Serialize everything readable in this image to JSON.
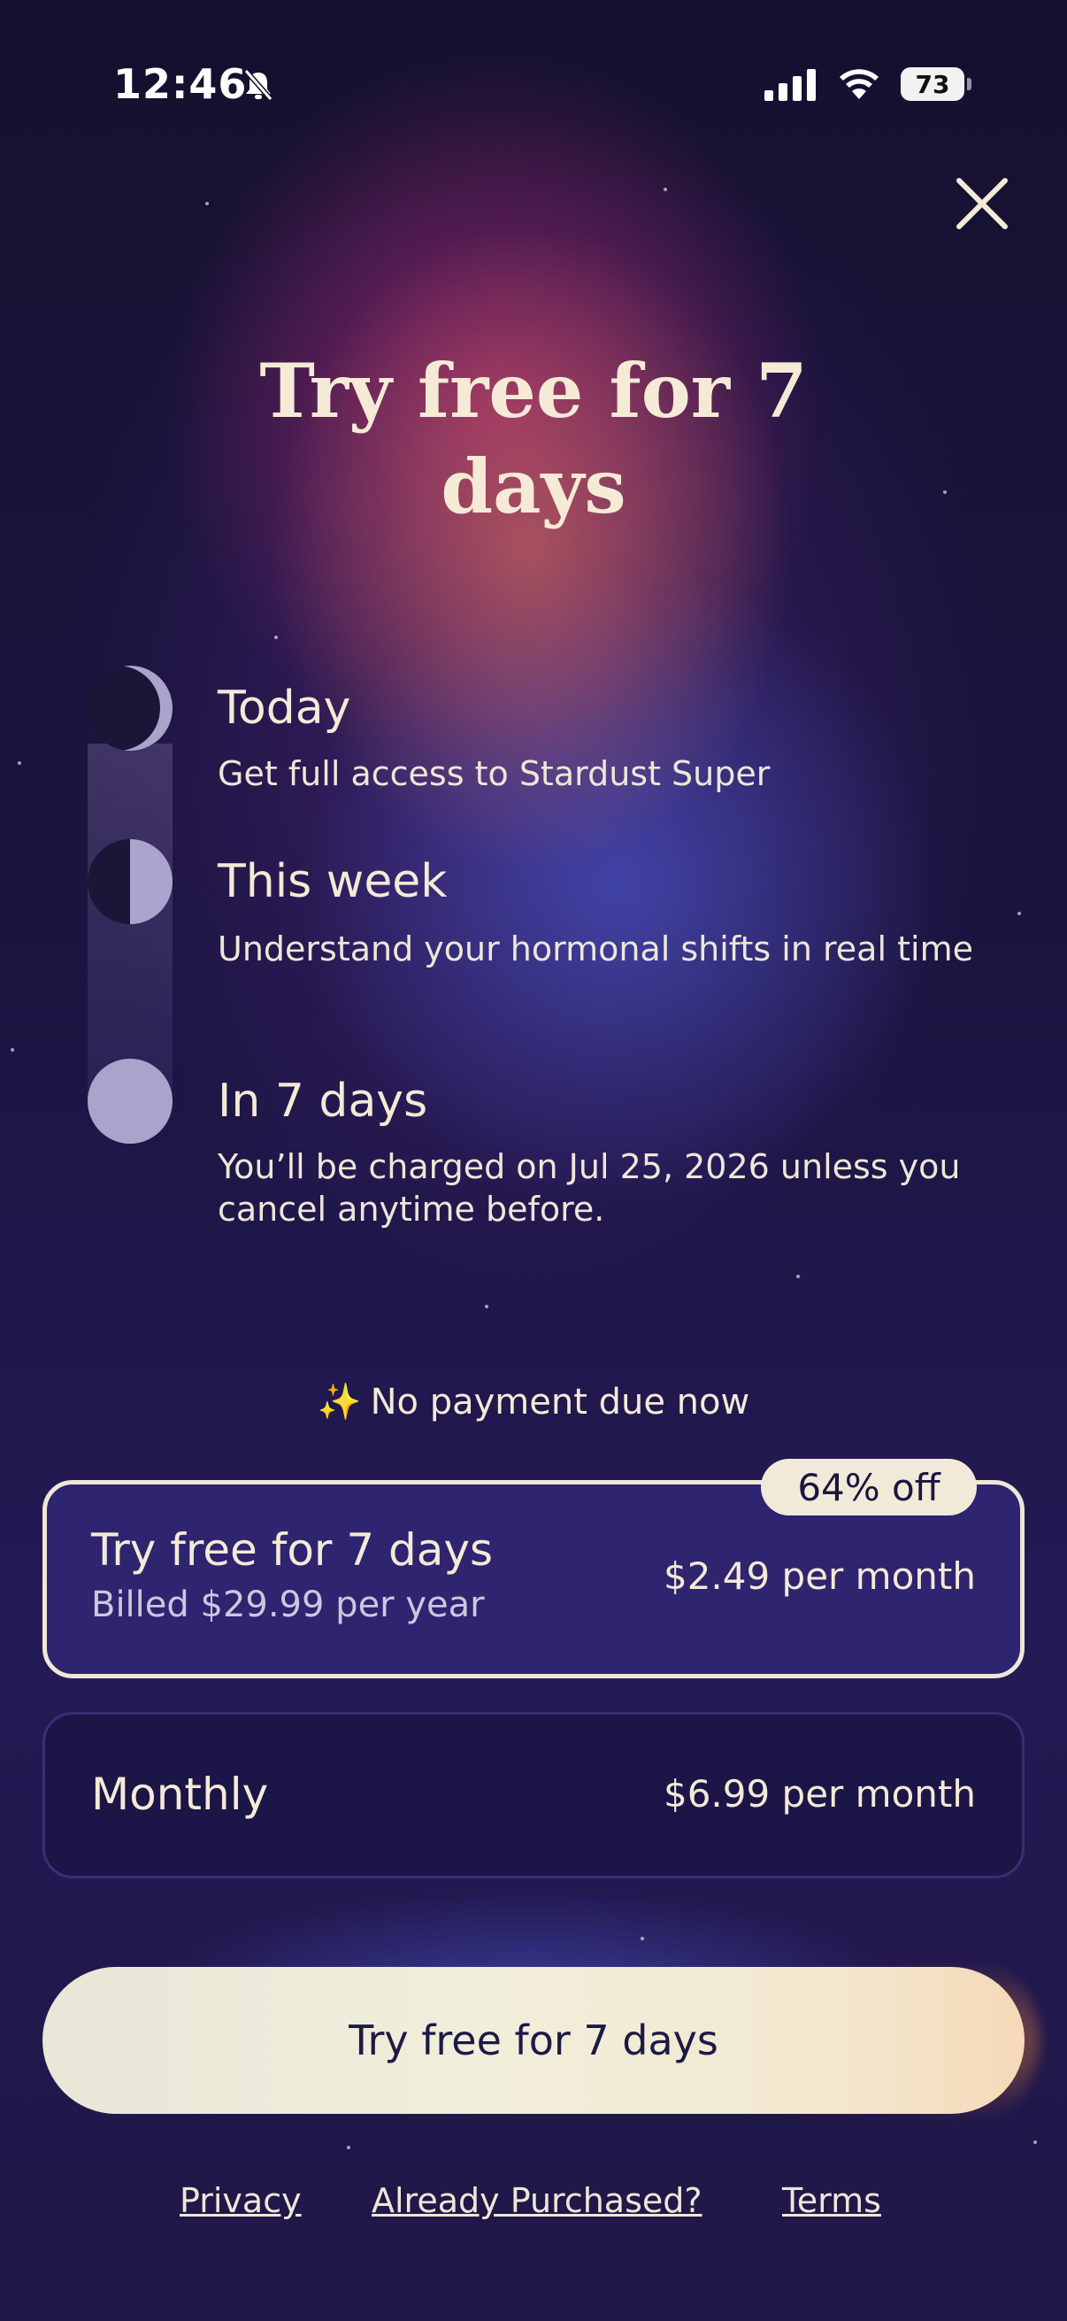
{
  "status_bar": {
    "time": "12:46",
    "battery": "73"
  },
  "paywall": {
    "title": "Try free for 7 days",
    "timeline": [
      {
        "title": "Today",
        "description": "Get full access to Stardust Super",
        "icon": "crescent-moon-icon"
      },
      {
        "title": "This week",
        "description": "Understand your hormonal shifts in real time",
        "icon": "half-moon-icon"
      },
      {
        "title": "In 7 days",
        "description": "You’ll be charged on Jul 25, 2026 unless you cancel anytime before.",
        "icon": "full-moon-icon"
      }
    ],
    "no_payment": "No payment due now",
    "plans": [
      {
        "name": "Try free for 7 days",
        "subtitle": "Billed $29.99 per year",
        "price": "$2.49 per month",
        "badge": "64% off",
        "selected": true
      },
      {
        "name": "Monthly",
        "price": "$6.99 per month",
        "selected": false
      }
    ],
    "cta_label": "Try free for 7 days",
    "footer_links": {
      "privacy": "Privacy",
      "already_purchased": "Already Purchased?",
      "terms": "Terms"
    }
  },
  "colors": {
    "text_cream": "#f4ead6",
    "card_selected": "#2e2470",
    "card_unselected": "#1c1548",
    "cta_text": "#1d1a45"
  }
}
